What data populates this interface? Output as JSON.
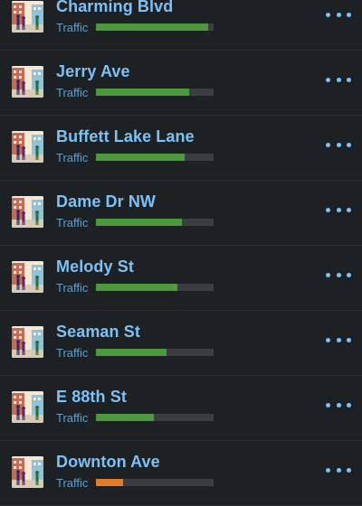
{
  "streets": [
    {
      "name": "Charming Blvd",
      "traffic_label": "Traffic",
      "traffic_level": 0.95,
      "status_color": "#4b9a3e",
      "icon": "street-scene-icon"
    },
    {
      "name": "Jerry Ave",
      "traffic_label": "Traffic",
      "traffic_level": 0.79,
      "status_color": "#4b9a3e",
      "icon": "street-scene-icon"
    },
    {
      "name": "Buffett Lake Lane",
      "traffic_label": "Traffic",
      "traffic_level": 0.75,
      "status_color": "#4b9a3e",
      "icon": "street-scene-icon"
    },
    {
      "name": "Dame Dr NW",
      "traffic_label": "Traffic",
      "traffic_level": 0.73,
      "status_color": "#4b9a3e",
      "icon": "street-scene-icon"
    },
    {
      "name": "Melody St",
      "traffic_label": "Traffic",
      "traffic_level": 0.69,
      "status_color": "#4b9a3e",
      "icon": "street-scene-icon"
    },
    {
      "name": "Seaman St",
      "traffic_label": "Traffic",
      "traffic_level": 0.6,
      "status_color": "#4b9a3e",
      "icon": "street-scene-icon"
    },
    {
      "name": "E 88th St",
      "traffic_label": "Traffic",
      "traffic_level": 0.49,
      "status_color": "#4b9a3e",
      "icon": "street-scene-icon"
    },
    {
      "name": "Downton Ave",
      "traffic_label": "Traffic",
      "traffic_level": 0.23,
      "status_color": "#e07b2c",
      "icon": "street-scene-icon"
    }
  ],
  "colors": {
    "accent": "#7cc1f5",
    "track": "#3a3d42",
    "background": "#1e2124"
  }
}
